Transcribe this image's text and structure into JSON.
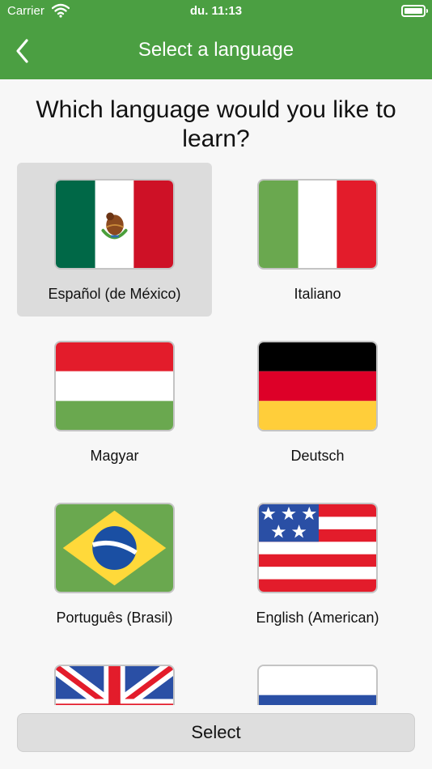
{
  "status": {
    "carrier": "Carrier",
    "time": "du. 11:13"
  },
  "header": {
    "title": "Select a language",
    "back_icon": "chevron-left-icon"
  },
  "question": "Which language would you like to learn?",
  "languages": [
    {
      "label": "Español (de México)",
      "flag": "mexico-flag-icon",
      "selected": true
    },
    {
      "label": "Italiano",
      "flag": "italy-flag-icon",
      "selected": false
    },
    {
      "label": "Magyar",
      "flag": "hungary-flag-icon",
      "selected": false
    },
    {
      "label": "Deutsch",
      "flag": "germany-flag-icon",
      "selected": false
    },
    {
      "label": "Português (Brasil)",
      "flag": "brazil-flag-icon",
      "selected": false
    },
    {
      "label": "English (American)",
      "flag": "usa-flag-icon",
      "selected": false
    },
    {
      "label": "",
      "flag": "uk-flag-icon",
      "selected": false
    },
    {
      "label": "",
      "flag": "netherlands-flag-icon",
      "selected": false
    }
  ],
  "footer": {
    "select_label": "Select"
  },
  "colors": {
    "header": "#4b9f42",
    "selected_bg": "#dcdcdc",
    "button_bg": "#dedede"
  }
}
